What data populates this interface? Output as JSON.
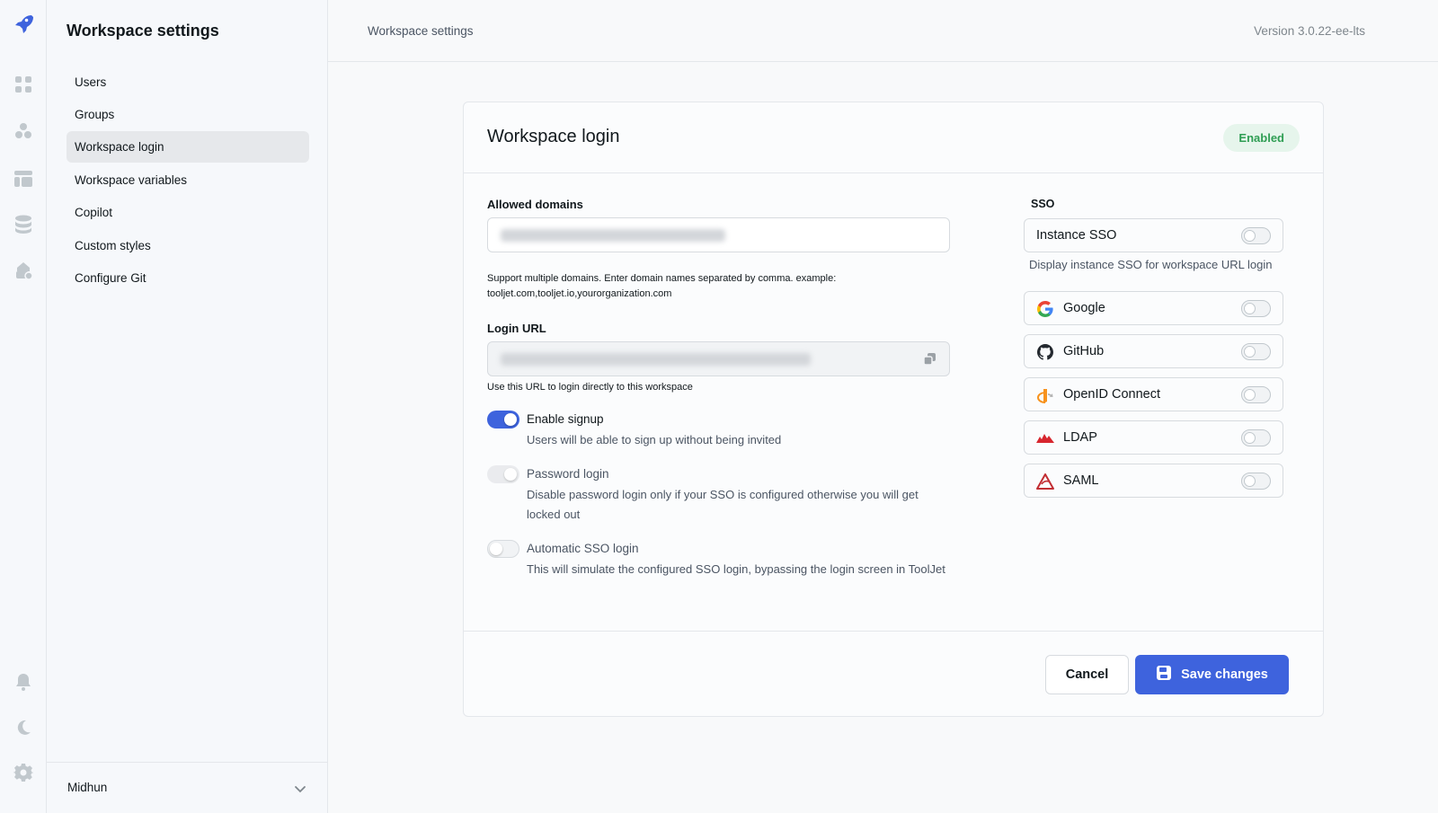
{
  "rail": {
    "icons": [
      "tooljet-logo-icon",
      "apps-grid-icon",
      "workflows-icon",
      "table-icon",
      "database-icon",
      "marketplace-icon",
      "bell-icon",
      "moon-icon",
      "gear-icon"
    ]
  },
  "sidebar": {
    "title": "Workspace settings",
    "items": [
      {
        "label": "Users",
        "active": false
      },
      {
        "label": "Groups",
        "active": false
      },
      {
        "label": "Workspace login",
        "active": true
      },
      {
        "label": "Workspace variables",
        "active": false
      },
      {
        "label": "Copilot",
        "active": false
      },
      {
        "label": "Custom styles",
        "active": false
      },
      {
        "label": "Configure Git",
        "active": false
      }
    ],
    "footer_user": "Midhun"
  },
  "header": {
    "breadcrumb": "Workspace settings",
    "version": "Version 3.0.22-ee-lts"
  },
  "card": {
    "title": "Workspace login",
    "status_badge": "Enabled",
    "allowed_domains": {
      "label": "Allowed domains",
      "value": "",
      "help_line1": "Support multiple domains. Enter domain names separated by comma. example:",
      "help_line2": "tooljet.com,tooljet.io,yourorganization.com"
    },
    "login_url": {
      "label": "Login URL",
      "value": "",
      "help": "Use this URL to login directly to this workspace"
    },
    "options": [
      {
        "title": "Enable signup",
        "desc": "Users will be able to sign up without being invited",
        "state": "on"
      },
      {
        "title": "Password login",
        "desc": "Disable password login only if your SSO is configured otherwise you will get locked out",
        "state": "disabled"
      },
      {
        "title": "Automatic SSO login",
        "desc": "This will simulate the configured SSO login, bypassing the login screen in ToolJet",
        "state": "off"
      }
    ],
    "sso": {
      "heading": "SSO",
      "instance": {
        "label": "Instance SSO",
        "enabled": false,
        "help": "Display instance SSO for workspace URL login"
      },
      "providers": [
        {
          "label": "Google",
          "icon": "google-icon",
          "enabled": false
        },
        {
          "label": "GitHub",
          "icon": "github-icon",
          "enabled": false
        },
        {
          "label": "OpenID Connect",
          "icon": "openid-icon",
          "enabled": false
        },
        {
          "label": "LDAP",
          "icon": "ldap-icon",
          "enabled": false
        },
        {
          "label": "SAML",
          "icon": "saml-icon",
          "enabled": false
        }
      ]
    },
    "buttons": {
      "cancel": "Cancel",
      "save": "Save changes"
    }
  },
  "colors": {
    "accent": "#3e63dd",
    "badge_bg": "#e6f5ec",
    "badge_text": "#2f9e54"
  }
}
